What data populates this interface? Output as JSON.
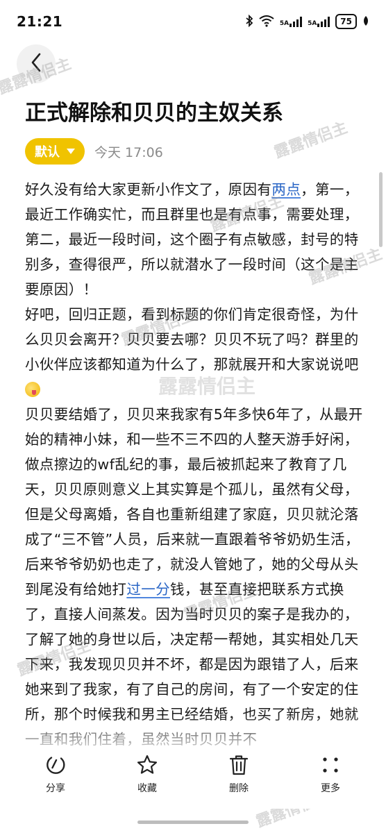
{
  "status_bar": {
    "time": "21:21",
    "signal1_label": "5A",
    "signal2_label": "5A",
    "battery": "75"
  },
  "title": "正式解除和贝贝的主奴关系",
  "meta": {
    "category": "默认",
    "time": "今天 17:06"
  },
  "content": {
    "p1_a": "好久没有给大家更新小作文了，原因有",
    "p1_link": "两点",
    "p1_b": "，第一，最近工作确实忙，而且群里也是有点事，需要处理，第二，最近一段时间，这个圈子有点敏感，封号的特别多，查得很严，所以就潜水了一段时间（这个是主要原因）！",
    "p2": "好吧，回归正题，看到标题的你们肯定很奇怪，为什么贝贝会离开？贝贝要去哪？贝贝不玩了吗？群里的小伙伴应该都知道为什么了，那就展开和大家说说吧",
    "p3_a": "贝贝要结婚了，贝贝来我家有5年多快6年了，从最开始的精神小妹，和一些不三不四的人整天游手好闲，做点擦边的wf乱纪的事，最后被抓起来了教育了几天，贝贝原则意义上其实算是个孤儿，虽然有父母，但是父母离婚，各自也重新组建了家庭，贝贝就沦落成了“三不管”人员，后来就一直跟着爷爷奶奶生活，后来爷爷奶奶也走了，就没人管她了，她的父母从头到尾没有给她打",
    "p3_link": "过一分",
    "p3_b": "钱，甚至直接把联系方式换了，直接人间蒸发。因为当时贝贝的案子是我办的，了解了她的身世以后，决定帮一帮她，其实相处几天下来，我发现贝贝并不坏，都是因为跟错了人，后来她来到了我家，有了自己的房间，有了一个安定的住所，那个时候我和男主已经结婚，也买了新房，她就一直和我们住着，虽然当时贝贝并不"
  },
  "bottom_bar": {
    "share": "分享",
    "favorite": "收藏",
    "delete": "删除",
    "more": "更多"
  },
  "watermark": "露露情侣主",
  "colors": {
    "accent": "#f0c300",
    "link": "#2a66c6"
  }
}
